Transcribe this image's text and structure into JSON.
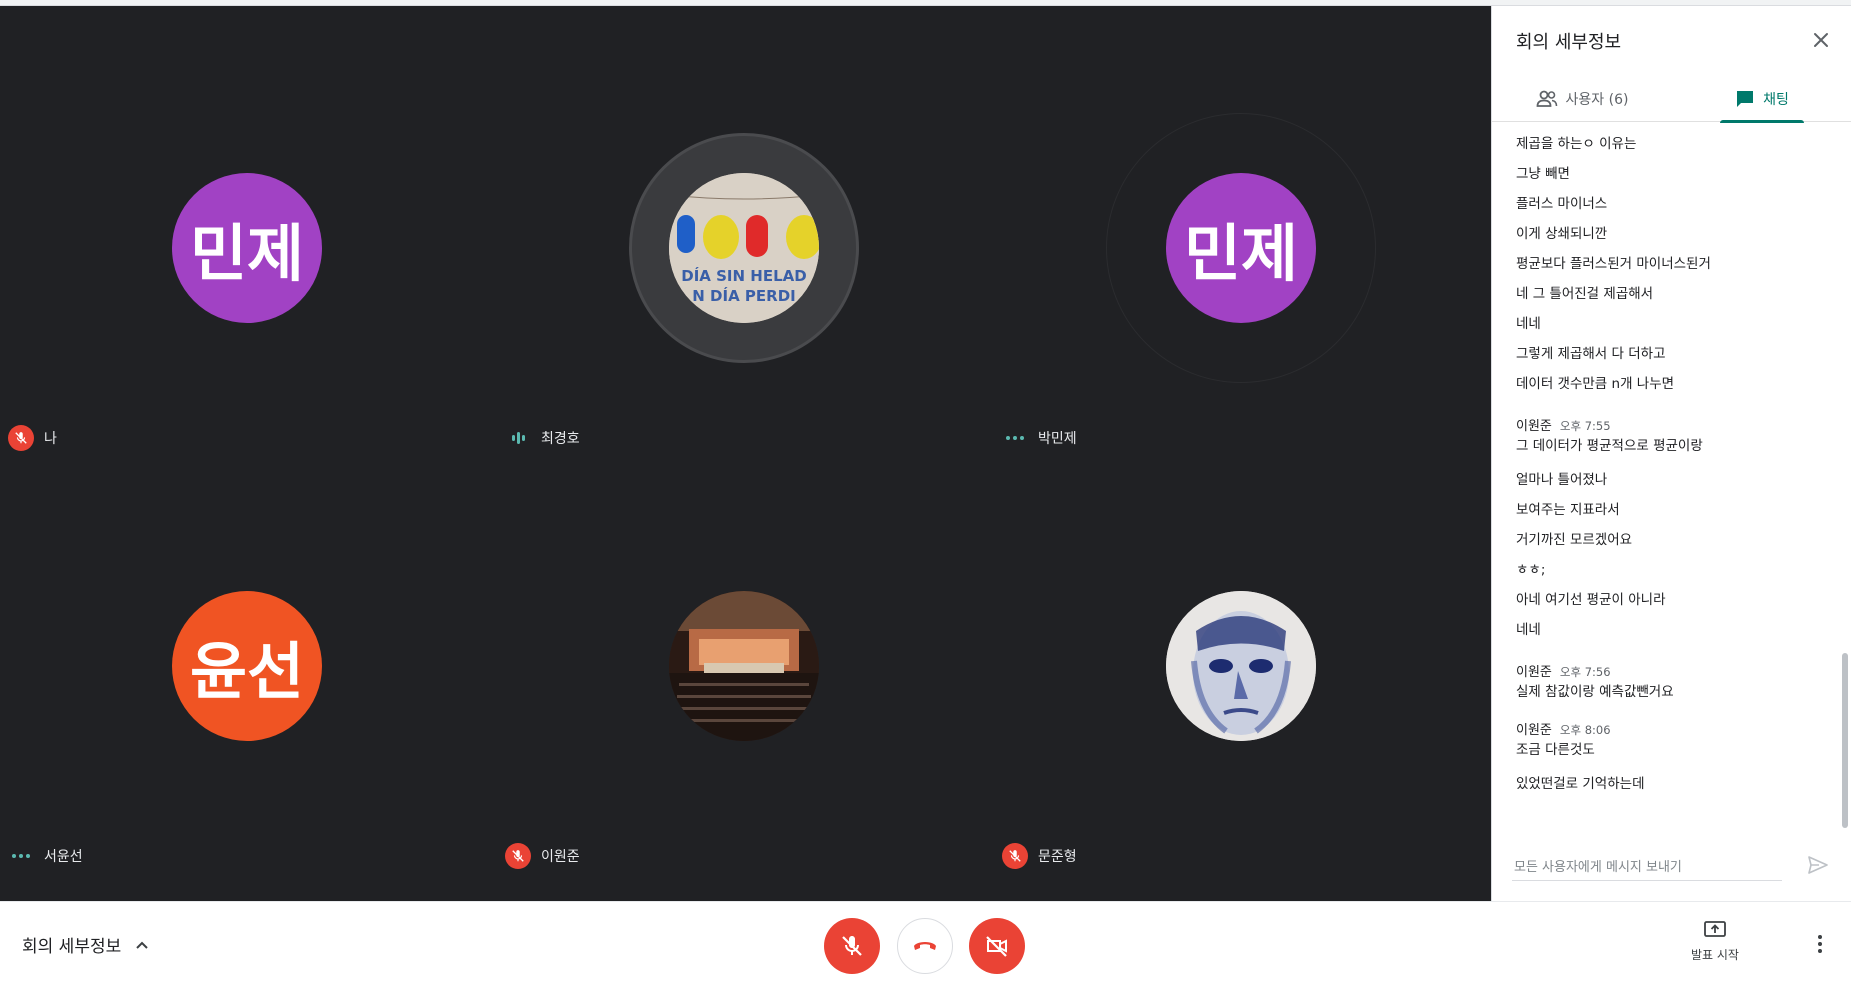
{
  "panel": {
    "title": "회의 세부정보",
    "tabs": [
      {
        "label": "사용자 (6)",
        "icon": "people-icon"
      },
      {
        "label": "채팅",
        "icon": "chat-icon",
        "active": true
      }
    ],
    "chat": {
      "messages_top": [
        "제곱을 하는ㅇ 이유는",
        "그냥 빼면",
        "플러스 마이너스",
        "이게 상쇄되니깐",
        "평균보다 플러스된거 마이너스된거",
        "네 그 틀어진걸 제곱해서",
        "네네",
        "그렇게 제곱해서 다 더하고",
        "데이터 갯수만큼 n개 나누면"
      ],
      "groups": [
        {
          "sender": "이원준",
          "time": "오후 7:55",
          "messages": [
            "그 데이터가 평균적으로 평균이랑",
            "얼마나 틀어졌나",
            "보여주는 지표라서",
            "거기까진 모르겠어요",
            "ㅎㅎ;",
            "아네 여기선 평균이 아니라",
            "네네"
          ]
        },
        {
          "sender": "이원준",
          "time": "오후 7:56",
          "messages": [
            "실제 참값이랑 예측값뺀거요"
          ]
        },
        {
          "sender": "이원준",
          "time": "오후 8:06",
          "messages": [
            "조금 다른것도",
            " 있었떤걸로 기억하는데"
          ]
        }
      ]
    },
    "compose_placeholder": "모든 사용자에게 메시지 보내기"
  },
  "participants": [
    {
      "name": "나",
      "avatar_text": "민제",
      "avatar_color": "#a142c4",
      "status": "muted"
    },
    {
      "name": "최경호",
      "avatar_text": "",
      "avatar_type": "photo-popsicles",
      "status": "speaking"
    },
    {
      "name": "박민제",
      "avatar_text": "민제",
      "avatar_color": "#a142c4",
      "status": "idle"
    },
    {
      "name": "서윤선",
      "avatar_text": "윤선",
      "avatar_color": "#f05423",
      "status": "idle"
    },
    {
      "name": "이원준",
      "avatar_text": "",
      "avatar_type": "photo-concert-hall",
      "status": "muted"
    },
    {
      "name": "문준형",
      "avatar_text": "",
      "avatar_type": "photo-painted-face",
      "status": "muted"
    }
  ],
  "photo_text": {
    "line1": "DÍA SIN HELAD",
    "line2": "N DÍA PERDI"
  },
  "bottombar": {
    "details_label": "회의 세부정보",
    "present_label": "발표 시작"
  },
  "colors": {
    "stage_bg": "#202124",
    "danger": "#ea4335",
    "accent": "#00796b",
    "activity": "#5bb9b0"
  }
}
